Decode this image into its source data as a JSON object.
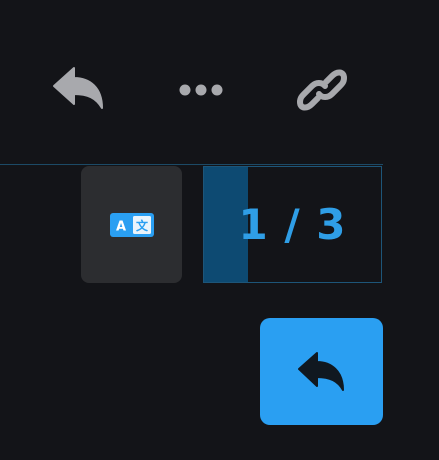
{
  "toolbar": {
    "icons": [
      "reply-icon",
      "more-icon",
      "link-icon"
    ],
    "icon_color": "#a8a9ad"
  },
  "translate": {
    "icon": "translate-icon",
    "badge_left": "A",
    "badge_right": "文",
    "accent": "#2a9ff2"
  },
  "pager": {
    "current": 1,
    "total": 3,
    "text": "1 / 3",
    "progress_fraction": 0.25,
    "accent": "#2f9ee6"
  },
  "reply_button": {
    "icon": "reply-icon",
    "background": "#2a9ff2"
  }
}
